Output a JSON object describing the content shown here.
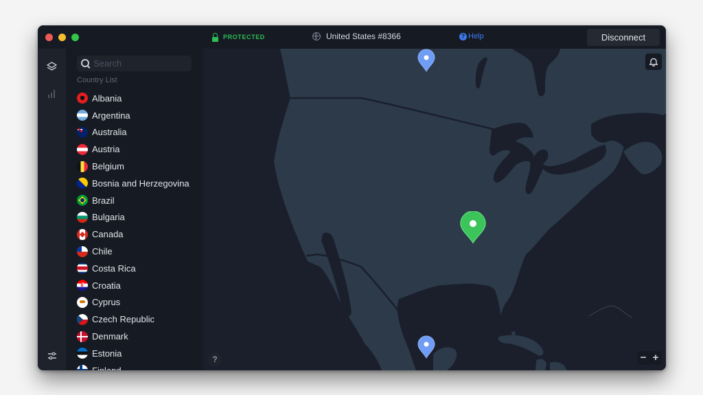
{
  "titlebar": {
    "status": "PROTECTED",
    "server": "United States #8366",
    "help_label": "Help",
    "help_icon_glyph": "?",
    "disconnect_label": "Disconnect"
  },
  "rail": {
    "icons": [
      "layers-icon",
      "stats-icon",
      "settings-sliders-icon"
    ]
  },
  "sidebar": {
    "search_placeholder": "Search",
    "search_value": "",
    "section_label": "Country List",
    "countries": [
      {
        "name": "Albania"
      },
      {
        "name": "Argentina"
      },
      {
        "name": "Australia"
      },
      {
        "name": "Austria"
      },
      {
        "name": "Belgium"
      },
      {
        "name": "Bosnia and Herzegovina"
      },
      {
        "name": "Brazil"
      },
      {
        "name": "Bulgaria"
      },
      {
        "name": "Canada"
      },
      {
        "name": "Chile"
      },
      {
        "name": "Costa Rica"
      },
      {
        "name": "Croatia"
      },
      {
        "name": "Cyprus"
      },
      {
        "name": "Czech Republic"
      },
      {
        "name": "Denmark"
      },
      {
        "name": "Estonia"
      },
      {
        "name": "Finland"
      }
    ]
  },
  "map": {
    "region": "North America",
    "help_button": "?",
    "zoom_out": "−",
    "zoom_in": "+",
    "pins": [
      {
        "label": "Canada server",
        "status": "available"
      },
      {
        "label": "United States server",
        "status": "connected"
      },
      {
        "label": "Mexico server",
        "status": "available"
      }
    ]
  },
  "colors": {
    "protected": "#2fbf55",
    "help": "#3d7cf0",
    "pin_connected": "#3bc45a",
    "pin_available": "#6f9cf5",
    "land": "#2c3a4a",
    "water": "#1a1f2b"
  }
}
